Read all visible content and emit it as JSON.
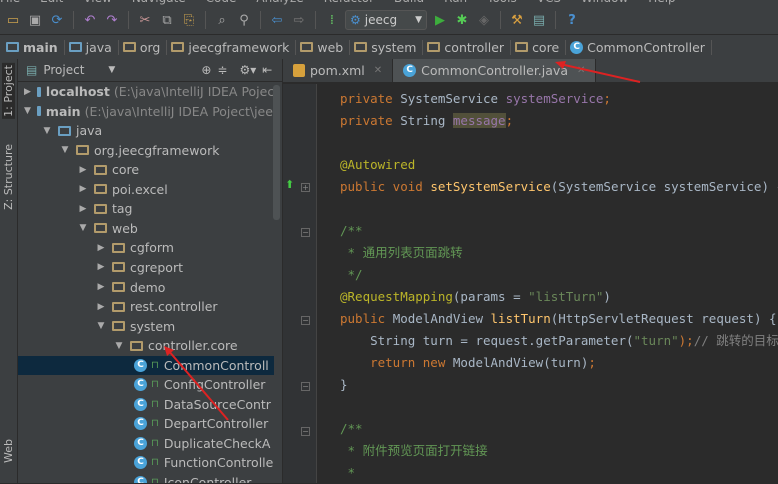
{
  "menu": [
    "File",
    "Edit",
    "View",
    "Navigate",
    "Code",
    "Analyze",
    "Refactor",
    "Build",
    "Run",
    "Tools",
    "VCS",
    "Window",
    "Help"
  ],
  "toolbar": {
    "run_config": "jeecg"
  },
  "breadcrumb": [
    "main",
    "java",
    "org",
    "jeecgframework",
    "web",
    "system",
    "controller",
    "core",
    "CommonController"
  ],
  "side_tabs": {
    "project": "1: Project",
    "structure": "Z: Structure",
    "web": "Web"
  },
  "panel": {
    "title": "Project"
  },
  "tree": [
    {
      "label": "localhost",
      "hint": "(E:\\java\\IntelliJ IDEA Poject\\jeecg",
      "depth": 0,
      "arrow": "right",
      "kind": "module"
    },
    {
      "label": "main",
      "hint": "(E:\\java\\IntelliJ IDEA Poject\\jeecg-f",
      "depth": 0,
      "arrow": "down",
      "kind": "module"
    },
    {
      "label": "java",
      "depth": 1,
      "arrow": "down",
      "kind": "src"
    },
    {
      "label": "org.jeecgframework",
      "depth": 2,
      "arrow": "down",
      "kind": "pkg"
    },
    {
      "label": "core",
      "depth": 3,
      "arrow": "right",
      "kind": "pkg"
    },
    {
      "label": "poi.excel",
      "depth": 3,
      "arrow": "right",
      "kind": "pkg"
    },
    {
      "label": "tag",
      "depth": 3,
      "arrow": "right",
      "kind": "pkg"
    },
    {
      "label": "web",
      "depth": 3,
      "arrow": "down",
      "kind": "pkg"
    },
    {
      "label": "cgform",
      "depth": 4,
      "arrow": "right",
      "kind": "pkg"
    },
    {
      "label": "cgreport",
      "depth": 4,
      "arrow": "right",
      "kind": "pkg"
    },
    {
      "label": "demo",
      "depth": 4,
      "arrow": "right",
      "kind": "pkg"
    },
    {
      "label": "rest.controller",
      "depth": 4,
      "arrow": "right",
      "kind": "pkg"
    },
    {
      "label": "system",
      "depth": 4,
      "arrow": "down",
      "kind": "pkg"
    },
    {
      "label": "controller.core",
      "depth": 5,
      "arrow": "down",
      "kind": "pkg"
    },
    {
      "label": "CommonControll",
      "depth": 6,
      "kind": "class",
      "selected": true
    },
    {
      "label": "ConfigController",
      "depth": 6,
      "kind": "class"
    },
    {
      "label": "DataSourceContr",
      "depth": 6,
      "kind": "class"
    },
    {
      "label": "DepartController",
      "depth": 6,
      "kind": "class"
    },
    {
      "label": "DuplicateCheckA",
      "depth": 6,
      "kind": "class"
    },
    {
      "label": "FunctionControlle",
      "depth": 6,
      "kind": "class"
    },
    {
      "label": "IconController",
      "depth": 6,
      "kind": "class"
    }
  ],
  "tabs": [
    {
      "label": "pom.xml",
      "icon": "xml"
    },
    {
      "label": "CommonController.java",
      "icon": "class",
      "active": true
    }
  ],
  "code": [
    [
      {
        "t": "private ",
        "k": "kw"
      },
      {
        "t": "SystemService ",
        "k": "ty"
      },
      {
        "t": "systemService",
        "k": "fld"
      },
      {
        "t": ";",
        "k": "kw"
      }
    ],
    [
      {
        "t": "private ",
        "k": "kw"
      },
      {
        "t": "String ",
        "k": "ty"
      },
      {
        "t": "message",
        "k": "fld hl"
      },
      {
        "t": ";",
        "k": "kw"
      }
    ],
    [],
    [
      {
        "t": "@Autowired",
        "k": "an"
      }
    ],
    [
      {
        "t": "public void ",
        "k": "kw"
      },
      {
        "t": "setSystemService",
        "k": "fn"
      },
      {
        "t": "(SystemService systemService) { th",
        "k": "pl"
      }
    ],
    [],
    [
      {
        "t": "/**",
        "k": "cm"
      }
    ],
    [
      {
        "t": " * 通用列表页面跳转",
        "k": "cm"
      }
    ],
    [
      {
        "t": " */",
        "k": "cm"
      }
    ],
    [
      {
        "t": "@RequestMapping",
        "k": "an"
      },
      {
        "t": "(params = ",
        "k": "pl"
      },
      {
        "t": "\"listTurn\"",
        "k": "str"
      },
      {
        "t": ")",
        "k": "pl"
      }
    ],
    [
      {
        "t": "public ",
        "k": "kw"
      },
      {
        "t": "ModelAndView ",
        "k": "pl"
      },
      {
        "t": "listTurn",
        "k": "fn"
      },
      {
        "t": "(HttpServletRequest request) {",
        "k": "pl"
      }
    ],
    [
      {
        "t": "    String turn = request.getParameter(",
        "k": "pl"
      },
      {
        "t": "\"turn\"",
        "k": "str"
      },
      {
        "t": ");",
        "k": "kw"
      },
      {
        "t": "// 跳转的目标页",
        "k": "lc"
      }
    ],
    [
      {
        "t": "    return new ",
        "k": "kw"
      },
      {
        "t": "ModelAndView(turn)",
        "k": "pl"
      },
      {
        "t": ";",
        "k": "kw"
      }
    ],
    [
      {
        "t": "}",
        "k": "pl"
      }
    ],
    [],
    [
      {
        "t": "/**",
        "k": "cm"
      }
    ],
    [
      {
        "t": " * 附件预览页面打开链接",
        "k": "cm"
      }
    ],
    [
      {
        "t": " *",
        "k": "cm"
      }
    ]
  ]
}
